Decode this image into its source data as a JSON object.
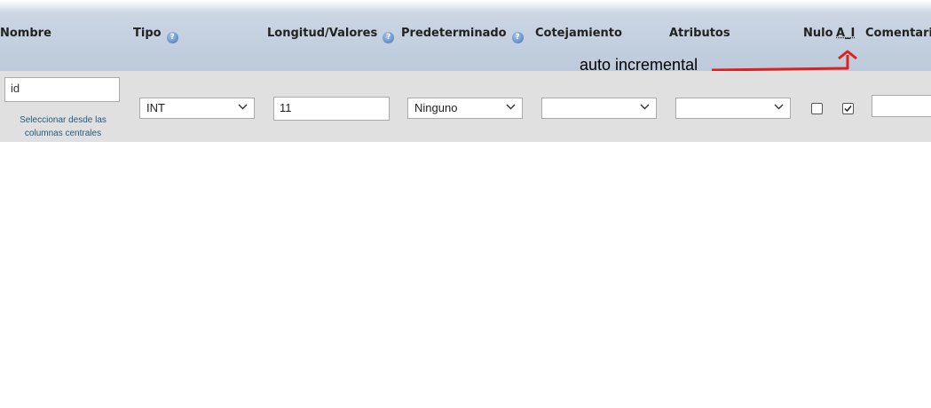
{
  "header": {
    "nombre": "Nombre",
    "tipo": "Tipo",
    "longitud": "Longitud/Valores",
    "predeterminado": "Predeterminado",
    "cotejamiento": "Cotejamiento",
    "atributos": "Atributos",
    "nulo": "Nulo",
    "ai": "A_I",
    "comentario": "Comentario"
  },
  "help_glyph": "?",
  "annotation": "auto incremental",
  "row": {
    "name_value": "id",
    "central_link": "Seleccionar desde las columnas centrales",
    "tipo_value": "INT",
    "longitud_value": "11",
    "predeterminado_value": "Ninguno",
    "cotejamiento_value": "",
    "atributos_value": "",
    "nulo_checked": false,
    "ai_checked": true,
    "comentario_value": ""
  },
  "colors": {
    "annotation_arrow": "#e0201c",
    "link": "#235a81",
    "header_bg": "#bccadb",
    "row_bg": "#e0e0e0"
  },
  "icons": {
    "help": "help-icon",
    "dropdown": "chevron-down-icon",
    "check": "checkmark-icon"
  }
}
